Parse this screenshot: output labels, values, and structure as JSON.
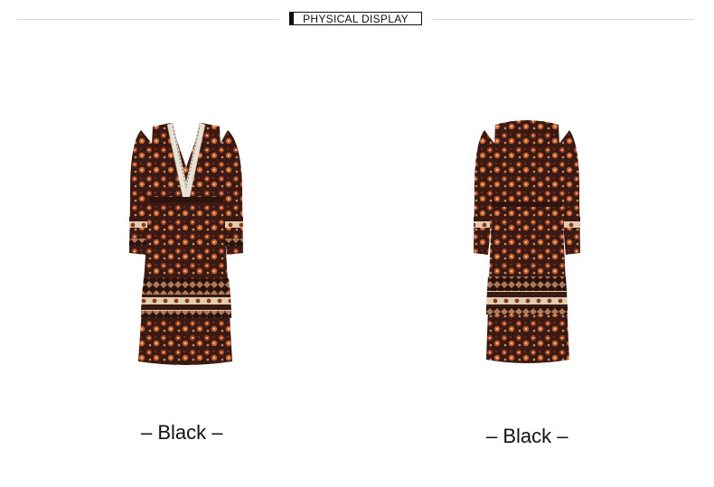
{
  "section": {
    "title": "PHYSICAL DISPLAY"
  },
  "products": [
    {
      "caption": "– Black –",
      "view": "front"
    },
    {
      "caption": "– Black –",
      "view": "back"
    }
  ],
  "colors": {
    "fabric_dark": "#3a1a14",
    "fabric_rust": "#a8441f",
    "fabric_cream": "#e8d2b6",
    "header_rule": "#d9d9d9"
  }
}
